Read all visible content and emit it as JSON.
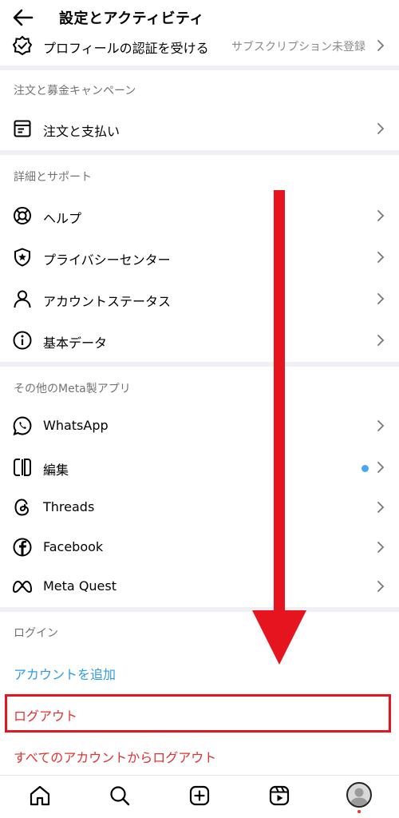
{
  "header": {
    "title": "設定とアクティビティ"
  },
  "rows": {
    "verification": {
      "label": "プロフィールの認証を受ける",
      "sub": "サブスクリプション未登録"
    },
    "orders": {
      "label": "注文と支払い"
    },
    "help": {
      "label": "ヘルプ"
    },
    "privacy_center": {
      "label": "プライバシーセンター"
    },
    "account_status": {
      "label": "アカウントステータス"
    },
    "about": {
      "label": "基本データ"
    },
    "whatsapp": {
      "label": "WhatsApp"
    },
    "edits": {
      "label": "編集"
    },
    "threads": {
      "label": "Threads"
    },
    "facebook": {
      "label": "Facebook"
    },
    "meta_quest": {
      "label": "Meta Quest"
    }
  },
  "sections": {
    "orders_fundraisers": "注文と募金キャンペーン",
    "more_info_support": "詳細とサポート",
    "other_meta_apps": "その他のMeta製アプリ",
    "login": "ログイン"
  },
  "login": {
    "add_account": "アカウントを追加",
    "log_out": "ログアウト",
    "log_out_all": "すべてのアカウントからログアウト"
  },
  "colors": {
    "link_blue": "#2f9be8",
    "danger_red": "#e0322e",
    "highlight_red": "#e5141f",
    "badge_blue": "#4aa6f0"
  },
  "icons": {
    "back": "arrow-left-icon",
    "verification": "verified-badge-icon",
    "orders": "receipt-icon",
    "help": "lifebuoy-icon",
    "privacy_center": "shield-star-icon",
    "account_status": "person-icon",
    "about": "info-icon",
    "whatsapp": "whatsapp-icon",
    "edits": "edits-icon",
    "threads": "threads-icon",
    "facebook": "facebook-icon",
    "meta_quest": "meta-icon",
    "nav": [
      "home-icon",
      "search-icon",
      "create-icon",
      "reels-icon",
      "profile-avatar"
    ]
  }
}
